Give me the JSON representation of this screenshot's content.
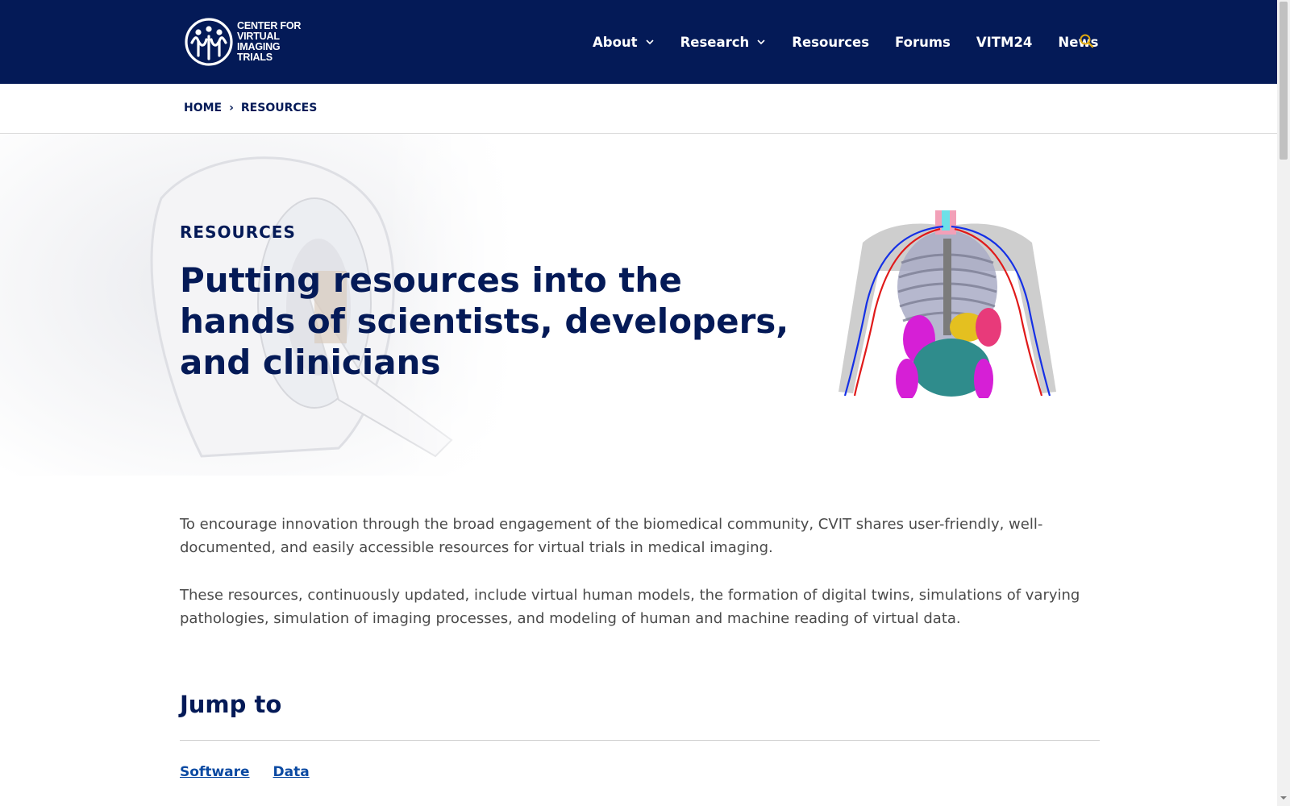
{
  "header": {
    "logo": {
      "lines": [
        "CENTER FOR",
        "VIRTUAL",
        "IMAGING",
        "TRIALS"
      ],
      "icon": "cvit-logo-icon"
    },
    "nav": [
      {
        "label": "About",
        "has_dropdown": true
      },
      {
        "label": "Research",
        "has_dropdown": true
      },
      {
        "label": "Resources",
        "has_dropdown": false
      },
      {
        "label": "Forums",
        "has_dropdown": false
      },
      {
        "label": "VITM24",
        "has_dropdown": false
      },
      {
        "label": "News",
        "has_dropdown": false
      }
    ],
    "search_icon": "search-icon"
  },
  "breadcrumb": {
    "home": "HOME",
    "separator": "›",
    "current": "RESOURCES"
  },
  "hero": {
    "eyebrow": "RESOURCES",
    "title": "Putting resources into the hands of scientists, developers, and clinicians",
    "figure": "virtual-human-anatomy-model"
  },
  "content": {
    "paragraphs": [
      "To encourage innovation through the broad engagement of the biomedical community, CVIT shares user-friendly, well-documented, and easily accessible resources for virtual trials in medical imaging.",
      "These resources, continuously updated, include virtual human models, the formation of digital twins, simulations of varying pathologies, simulation of imaging processes, and modeling of human and machine reading of virtual data."
    ],
    "jump_to": {
      "title": "Jump to",
      "links": [
        "Software",
        "Data"
      ]
    }
  },
  "colors": {
    "brand_navy": "#041a57",
    "search_gold": "#e0a80f",
    "link_blue": "#0b4aa2",
    "body_text": "#4a4a4a"
  }
}
